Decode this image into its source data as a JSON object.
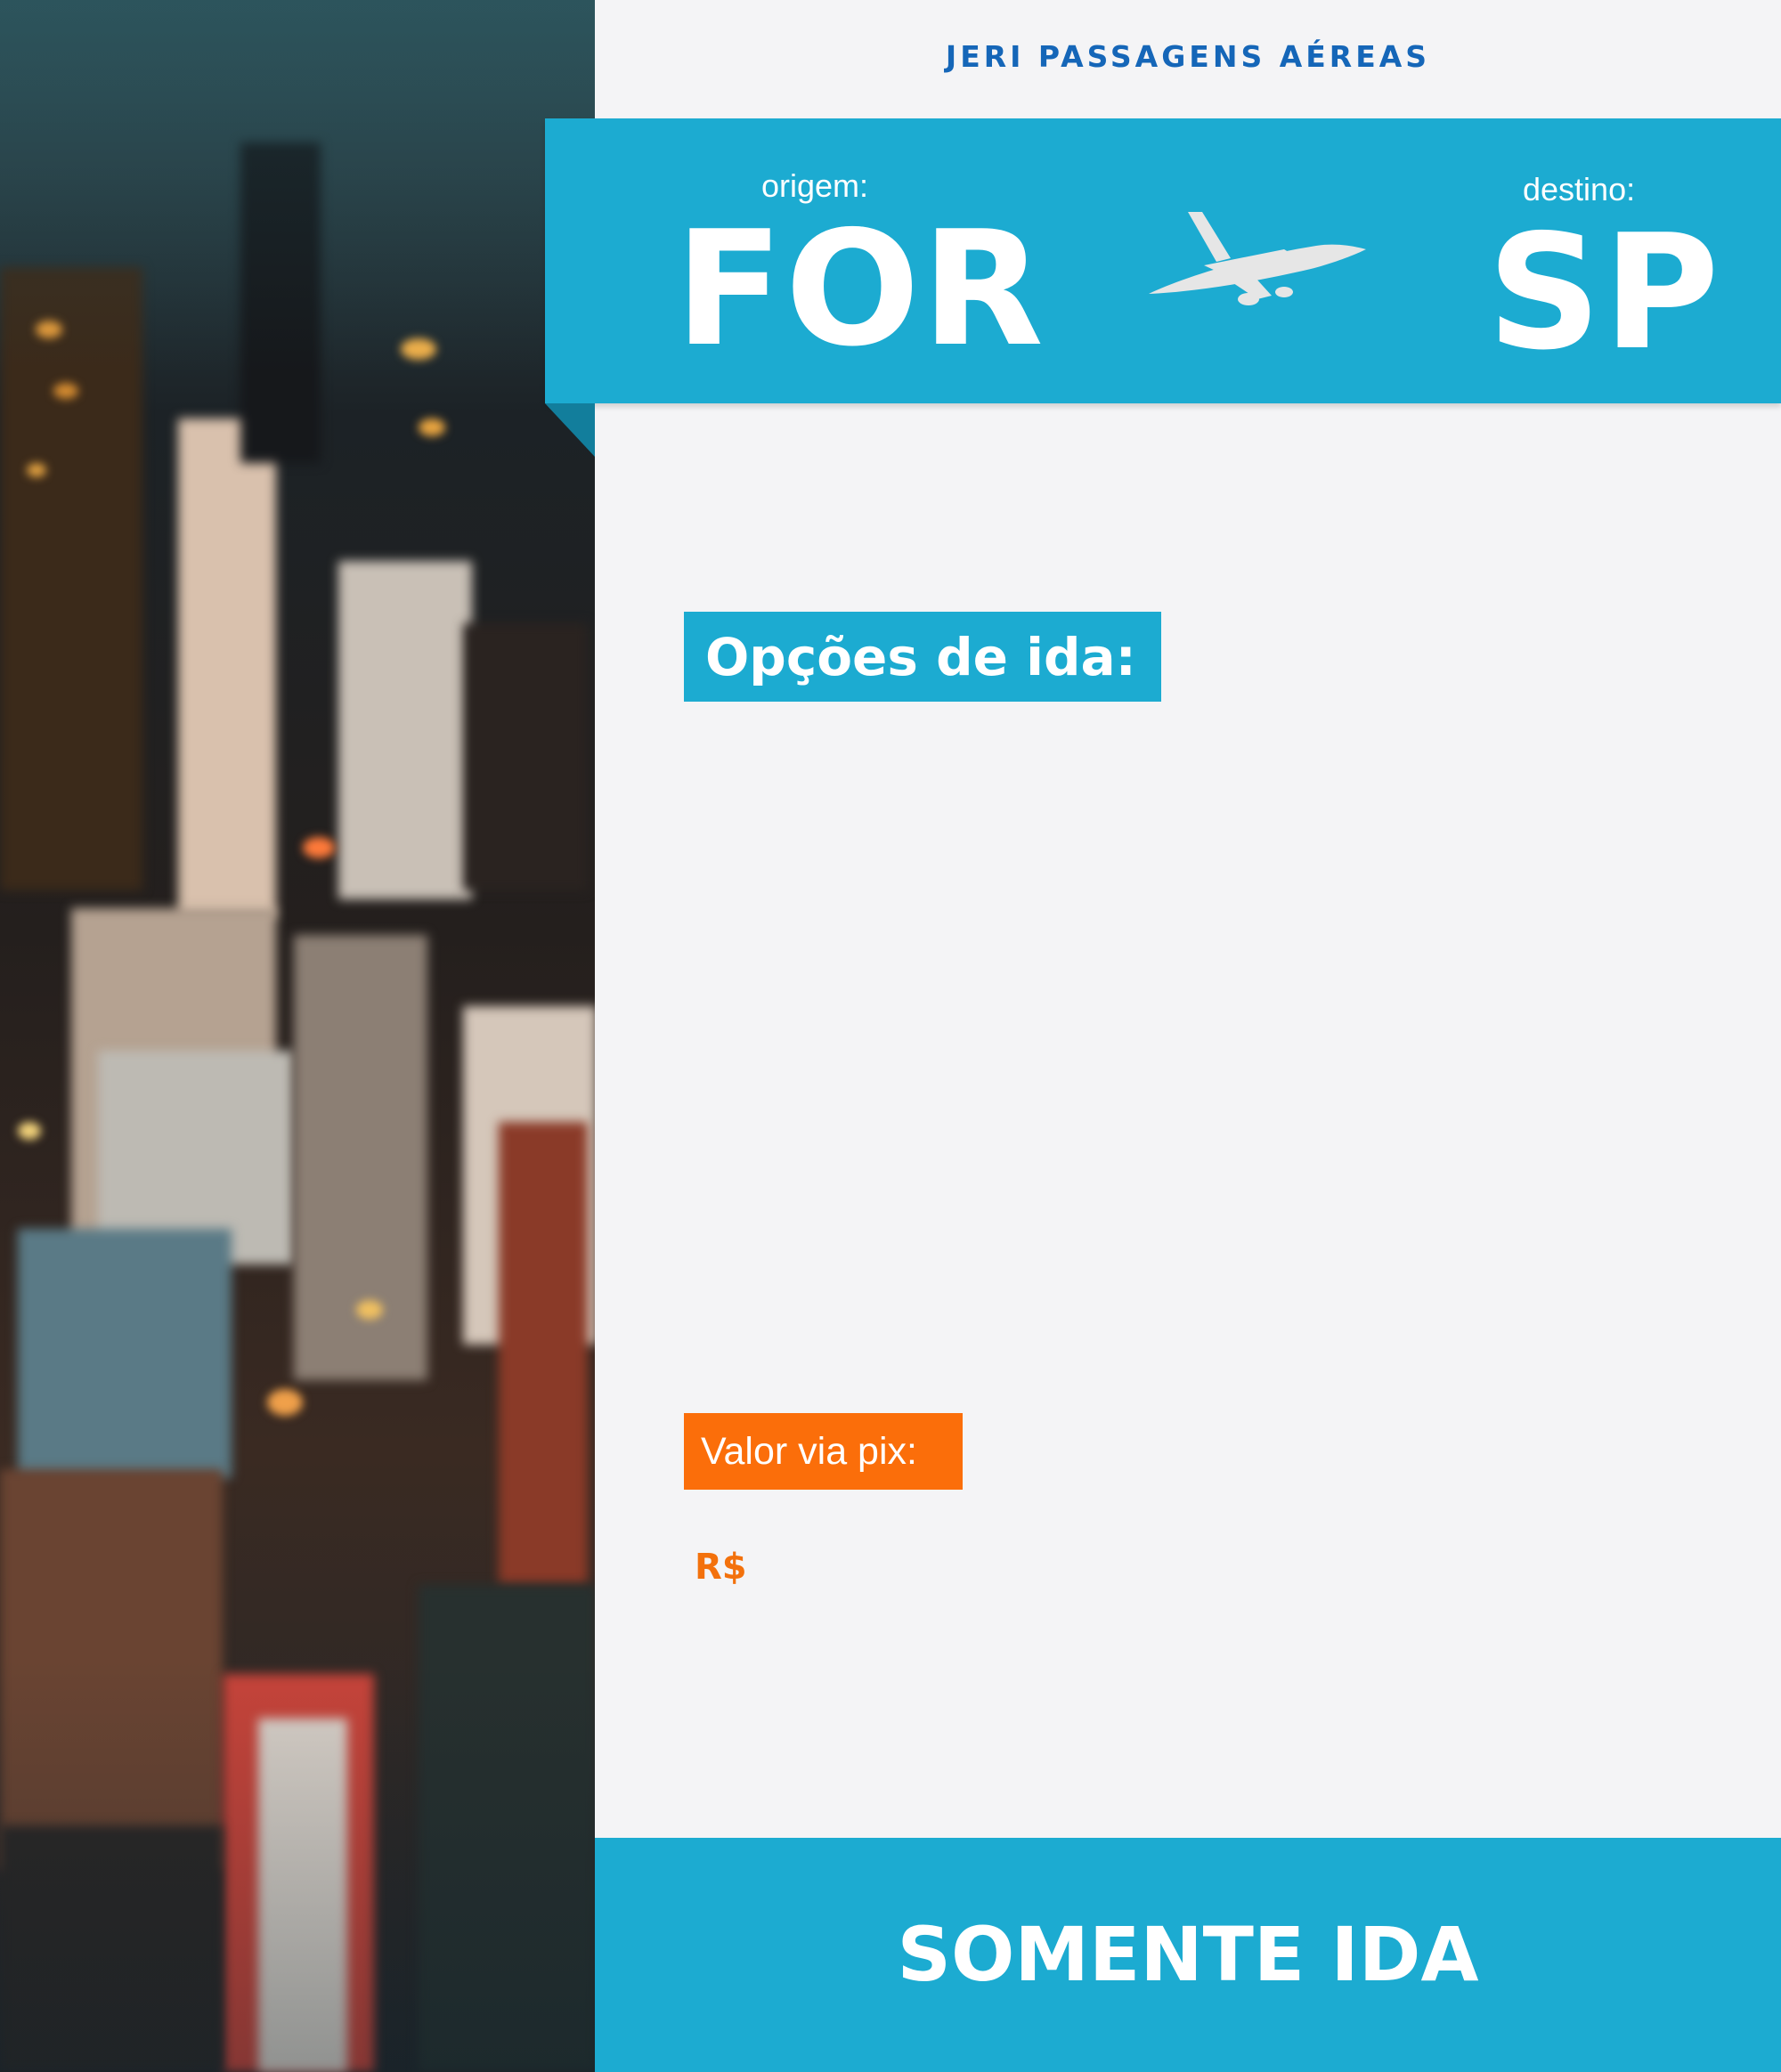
{
  "brand": "JERI PASSAGENS AÉREAS",
  "route": {
    "origin_label": "origem:",
    "origin_code": "FOR",
    "destination_label": "destino:",
    "destination_code": "SP"
  },
  "options_heading": "Opções de ida:",
  "price": {
    "label": "Valor via pix:",
    "currency": "R$"
  },
  "footer": "SOMENTE IDA",
  "colors": {
    "band_blue": "#1cabd1",
    "brand_blue": "#1566b8",
    "orange": "#fb6e0a",
    "background": "#f4f4f6"
  }
}
